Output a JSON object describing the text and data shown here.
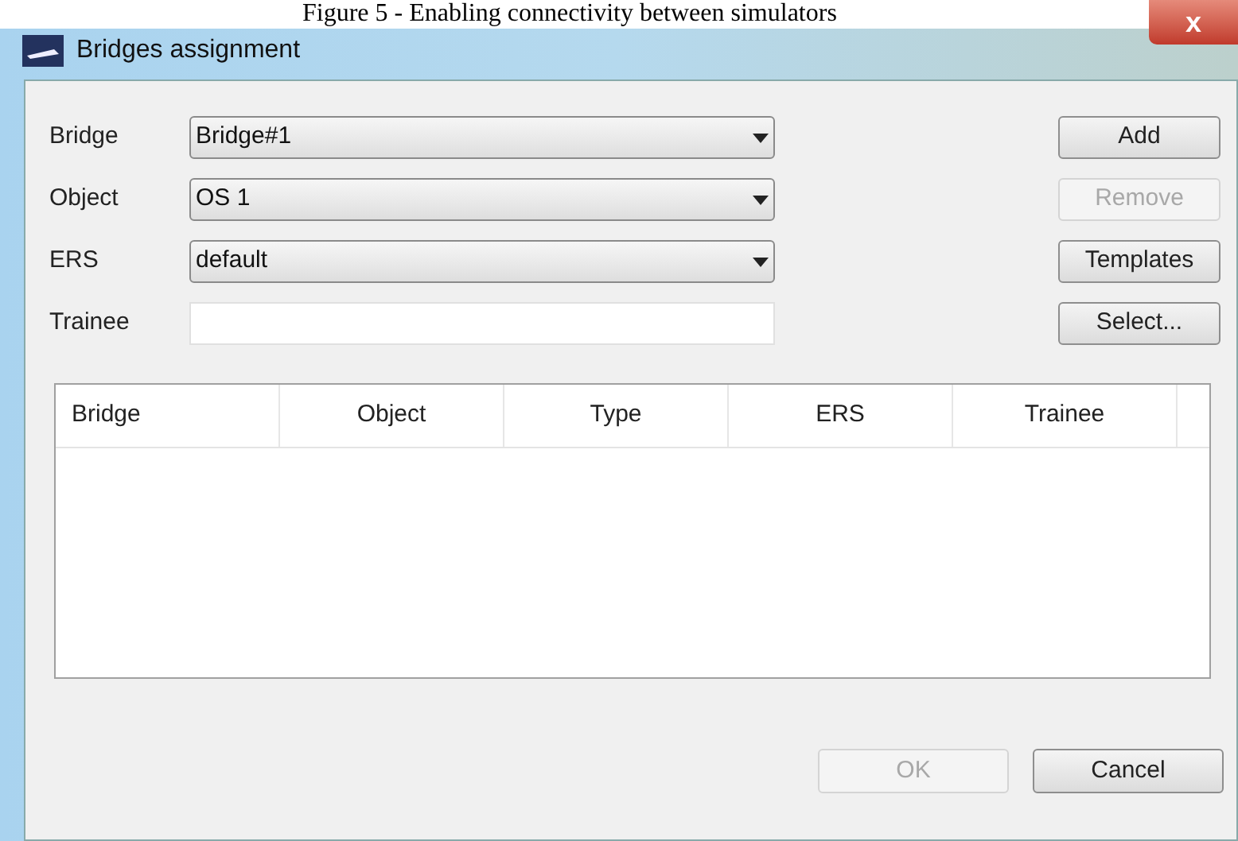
{
  "caption": "Figure 5 - Enabling connectivity between simulators",
  "window": {
    "title": "Bridges assignment",
    "close": "x"
  },
  "fields": [
    {
      "label": "Bridge",
      "kind": "combo",
      "value": "Bridge#1"
    },
    {
      "label": "Object",
      "kind": "combo",
      "value": "OS 1"
    },
    {
      "label": "ERS",
      "kind": "combo",
      "value": "default"
    },
    {
      "label": "Trainee",
      "kind": "text"
    }
  ],
  "side_buttons": [
    {
      "label": "Add",
      "disabled": false
    },
    {
      "label": "Remove",
      "disabled": true
    },
    {
      "label": "Templates",
      "disabled": false
    },
    {
      "label": "Select...",
      "disabled": false
    }
  ],
  "table": {
    "columns": [
      "Bridge",
      "Object",
      "Type",
      "ERS",
      "Trainee"
    ]
  },
  "buttons": [
    {
      "label": "OK",
      "disabled": true
    },
    {
      "label": "Cancel",
      "disabled": false
    }
  ]
}
